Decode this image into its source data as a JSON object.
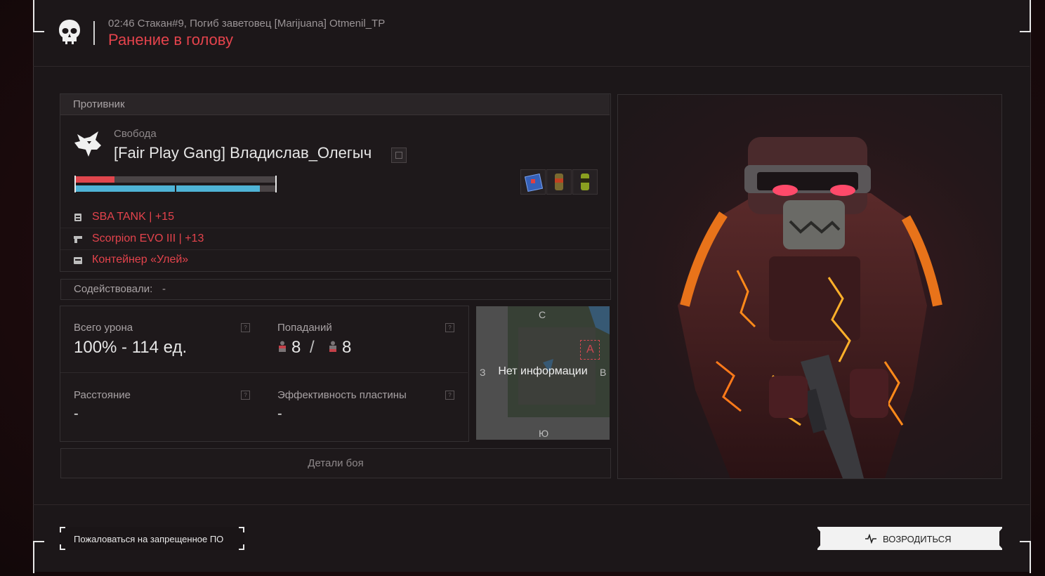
{
  "header": {
    "log": "02:46 Стакан#9, Погиб заветовец [Marijuana] Otmenil_TP",
    "cause": "Ранение в голову"
  },
  "enemy": {
    "section_label": "Противник",
    "faction": "Свобода",
    "player_name": "[Fair Play Gang] Владислав_Олегыч",
    "health_fraction": 0.2,
    "armor_fraction": 0.92,
    "items": [
      {
        "icon": "armor-icon",
        "label": "SBA TANK | +15"
      },
      {
        "icon": "gun-icon",
        "label": "Scorpion EVO III | +13"
      },
      {
        "icon": "container-icon",
        "label": "Контейнер «Улей»"
      }
    ],
    "artifacts": [
      "first-aid-kit-icon",
      "energy-drink-icon",
      "stimulant-icon"
    ]
  },
  "assist": {
    "label": "Содействовали:",
    "value": "-"
  },
  "stats": {
    "total_damage_label": "Всего урона",
    "total_damage_value": "100% - 114 ед.",
    "hits_label": "Попаданий",
    "hits_a": "8",
    "hits_sep": "/",
    "hits_b": "8",
    "distance_label": "Расстояние",
    "distance_value": "-",
    "plate_label": "Эффективность пластины",
    "plate_value": "-",
    "help_glyph": "?"
  },
  "minimap": {
    "no_info": "Нет информации",
    "north": "С",
    "south": "Ю",
    "west": "З",
    "east": "В",
    "marker": "А"
  },
  "details_button": "Детали боя",
  "footer": {
    "report_label": "Пожаловаться на запрещенное ПО",
    "respawn_label": "ВОЗРОДИТЬСЯ"
  },
  "colors": {
    "accent_red": "#e4434c",
    "health": "#e0464d",
    "armor": "#4fb3d6"
  }
}
